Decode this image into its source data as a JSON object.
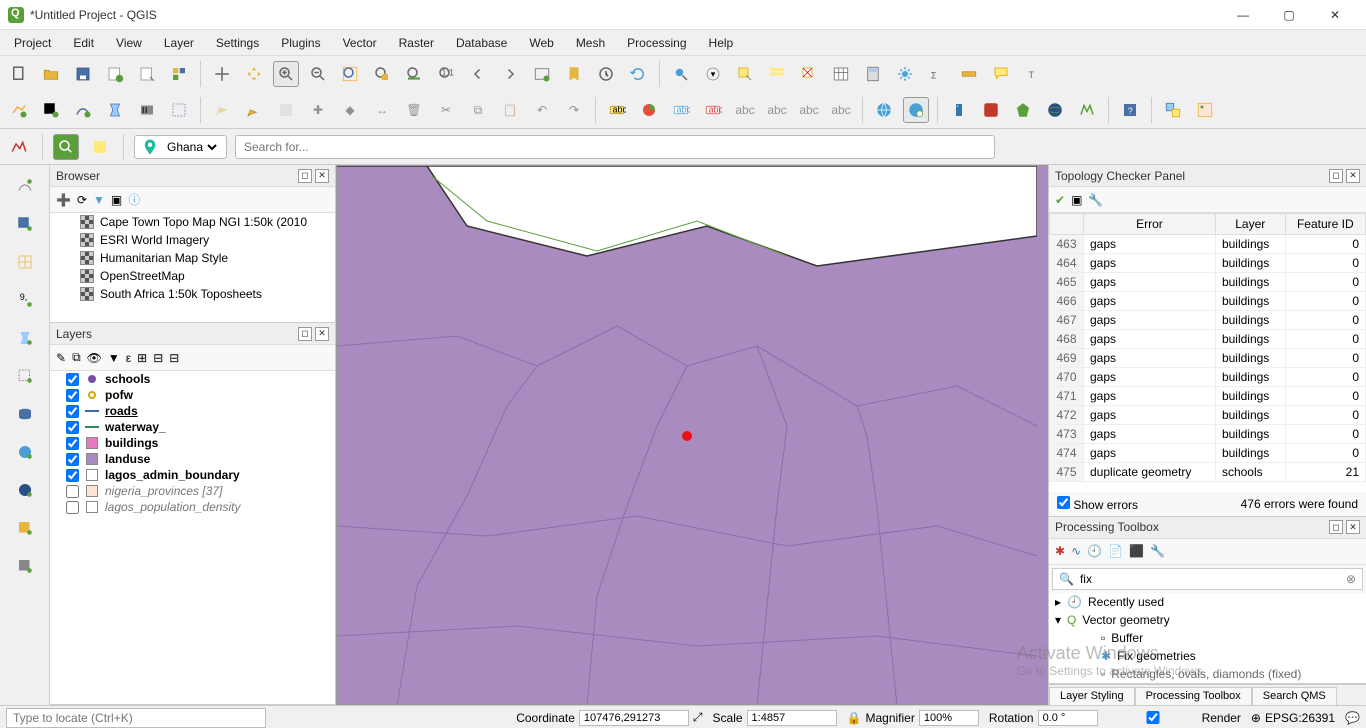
{
  "title": "*Untitled Project - QGIS",
  "menu": [
    "Project",
    "Edit",
    "View",
    "Layer",
    "Settings",
    "Plugins",
    "Vector",
    "Raster",
    "Database",
    "Web",
    "Mesh",
    "Processing",
    "Help"
  ],
  "location_selection": "Ghana",
  "search_placeholder": "Search for...",
  "browser": {
    "title": "Browser",
    "items": [
      "Cape Town Topo Map NGI 1:50k (2010",
      "ESRI World Imagery",
      "Humanitarian Map Style",
      "OpenStreetMap",
      "South Africa 1:50k Toposheets"
    ]
  },
  "layers": {
    "title": "Layers",
    "items": [
      {
        "checked": true,
        "sym": "dot",
        "color": "#7a4fa3",
        "name": "schools",
        "bold": true
      },
      {
        "checked": true,
        "sym": "ring",
        "color": "#d6a400",
        "name": "pofw",
        "bold": true
      },
      {
        "checked": true,
        "sym": "line",
        "color": "#3a6ea5",
        "name": "roads",
        "bold": true,
        "underline": true
      },
      {
        "checked": true,
        "sym": "line",
        "color": "#2e8b57",
        "name": "waterway_",
        "bold": true
      },
      {
        "checked": true,
        "sym": "rect",
        "color": "#e97ac0",
        "name": "buildings",
        "bold": true
      },
      {
        "checked": true,
        "sym": "rect",
        "color": "#a98bc0",
        "name": "landuse",
        "bold": true
      },
      {
        "checked": true,
        "sym": "rect",
        "color": "#ffffff",
        "name": "lagos_admin_boundary",
        "bold": true
      },
      {
        "checked": false,
        "sym": "rect",
        "color": "#fde4d4",
        "name": "nigeria_provinces [37]",
        "italic": true
      },
      {
        "checked": false,
        "sym": "rect",
        "color": "#ffffff",
        "name": "lagos_population_density",
        "italic": true
      }
    ]
  },
  "topology": {
    "title": "Topology Checker Panel",
    "headers": [
      "Error",
      "Layer",
      "Feature ID"
    ],
    "rows": [
      {
        "n": 463,
        "error": "gaps",
        "layer": "buildings",
        "fid": 0
      },
      {
        "n": 464,
        "error": "gaps",
        "layer": "buildings",
        "fid": 0
      },
      {
        "n": 465,
        "error": "gaps",
        "layer": "buildings",
        "fid": 0
      },
      {
        "n": 466,
        "error": "gaps",
        "layer": "buildings",
        "fid": 0
      },
      {
        "n": 467,
        "error": "gaps",
        "layer": "buildings",
        "fid": 0
      },
      {
        "n": 468,
        "error": "gaps",
        "layer": "buildings",
        "fid": 0
      },
      {
        "n": 469,
        "error": "gaps",
        "layer": "buildings",
        "fid": 0
      },
      {
        "n": 470,
        "error": "gaps",
        "layer": "buildings",
        "fid": 0
      },
      {
        "n": 471,
        "error": "gaps",
        "layer": "buildings",
        "fid": 0
      },
      {
        "n": 472,
        "error": "gaps",
        "layer": "buildings",
        "fid": 0
      },
      {
        "n": 473,
        "error": "gaps",
        "layer": "buildings",
        "fid": 0
      },
      {
        "n": 474,
        "error": "gaps",
        "layer": "buildings",
        "fid": 0
      },
      {
        "n": 475,
        "error": "duplicate geometry",
        "layer": "schools",
        "fid": 21
      }
    ],
    "show_errors_label": "Show errors",
    "show_errors_checked": true,
    "summary": "476 errors were found"
  },
  "processing": {
    "title": "Processing Toolbox",
    "search_value": "fix",
    "tree": {
      "recent": "Recently used",
      "group": "Vector geometry",
      "children": [
        "Buffer",
        "Fix geometries",
        "Rectangles, ovals, diamonds (fixed)"
      ]
    }
  },
  "bottom_tabs": [
    "Layer Styling",
    "Processing Toolbox",
    "Search QMS"
  ],
  "status": {
    "locate_placeholder": "Type to locate (Ctrl+K)",
    "coord_label": "Coordinate",
    "coord_value": "107476,291273",
    "scale_label": "Scale",
    "scale_value": "1:4857",
    "magnifier_label": "Magnifier",
    "magnifier_value": "100%",
    "rotation_label": "Rotation",
    "rotation_value": "0.0 °",
    "render_label": "Render",
    "render_checked": true,
    "crs": "EPSG:26391"
  },
  "watermark_line1": "Activate Windows",
  "watermark_line2": "Go to Settings to activate Windows."
}
